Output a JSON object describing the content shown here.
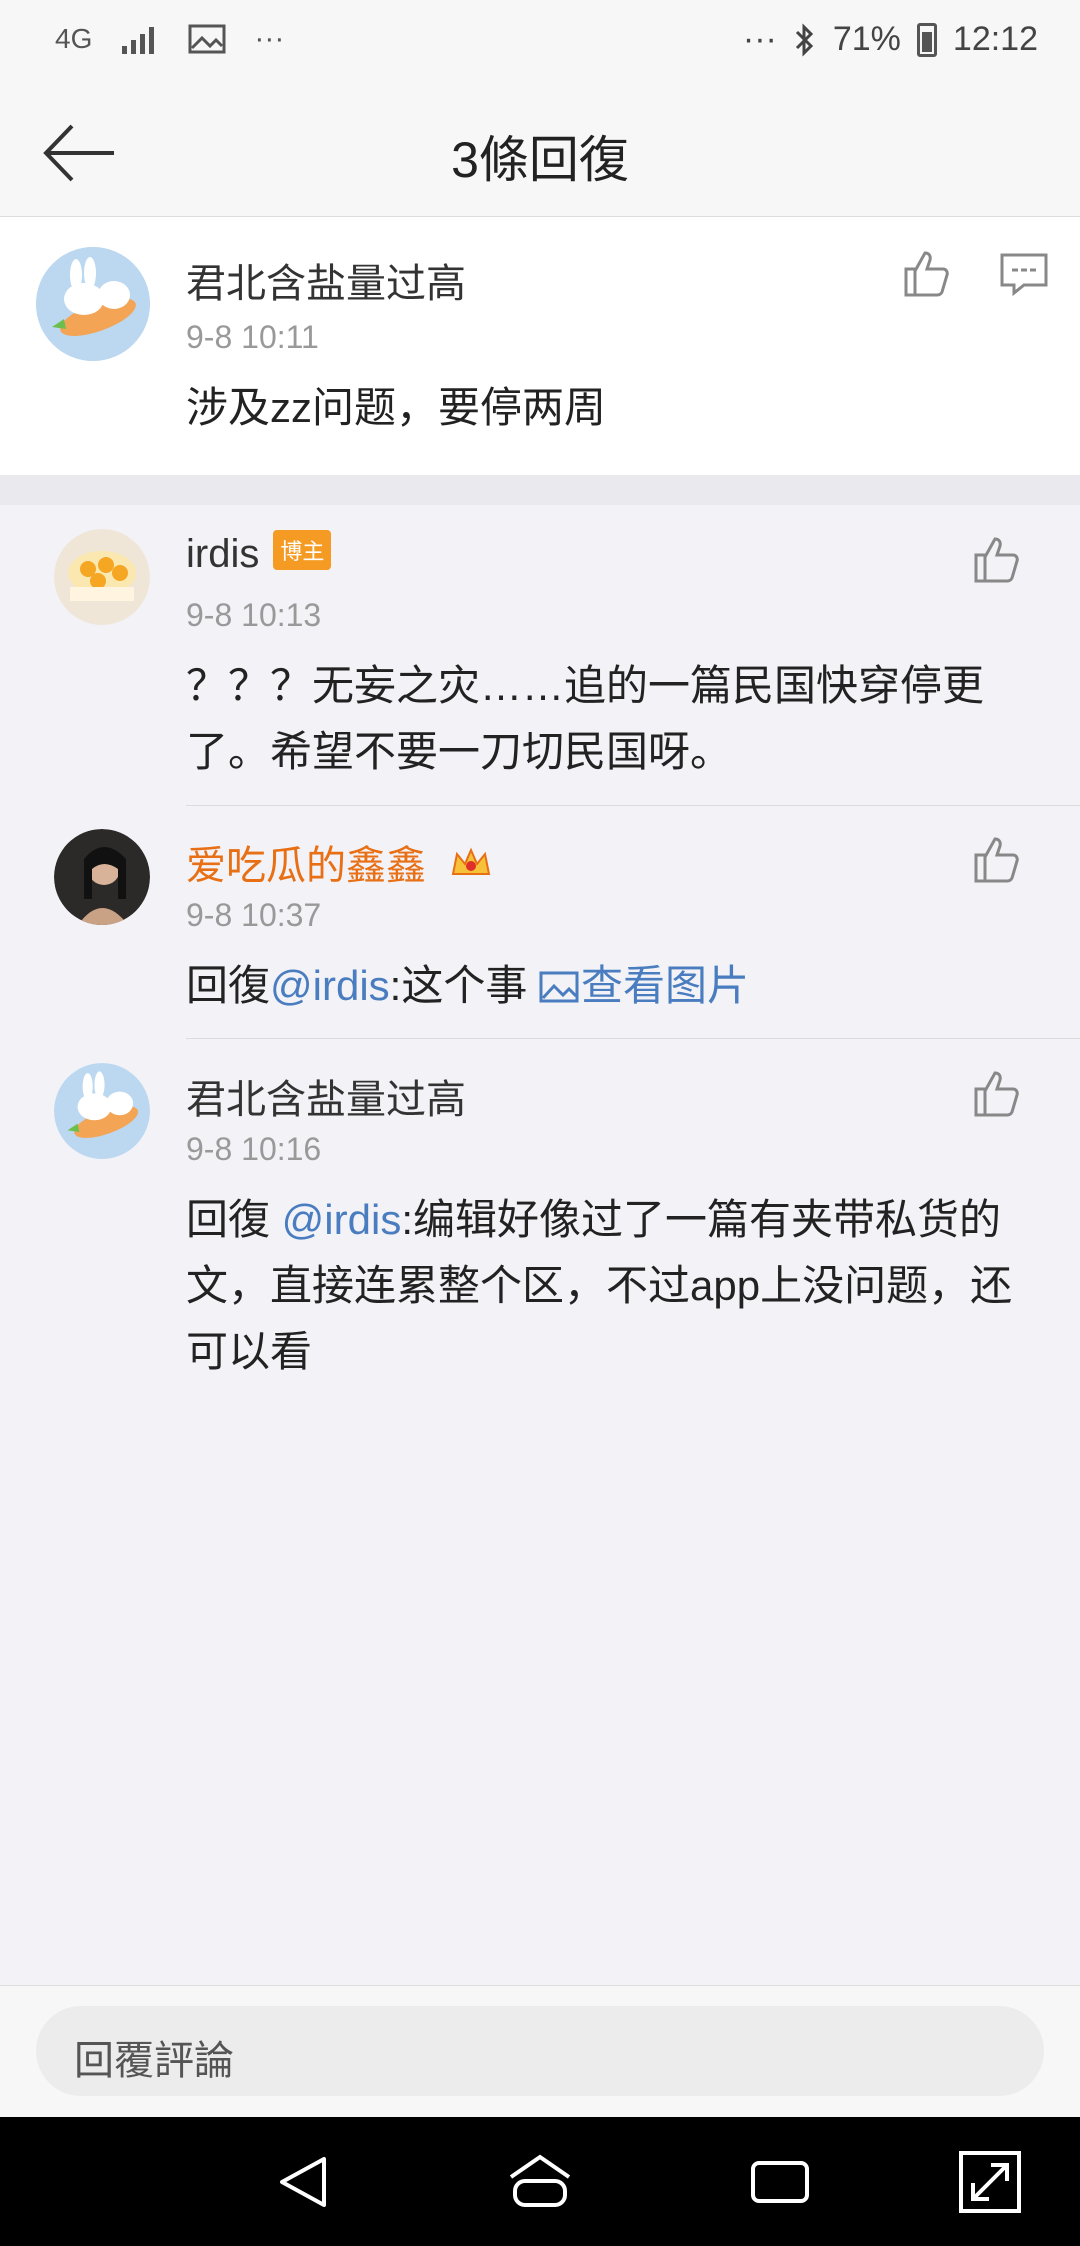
{
  "status_bar": {
    "network": "4G",
    "dots_left": "···",
    "dots_right": "···",
    "battery": "71%",
    "time": "12:12"
  },
  "header": {
    "title": "3條回復"
  },
  "root_comment": {
    "author": "君北含盐量过高",
    "time": "9-8 10:11",
    "text": "涉及zz问题，要停两周"
  },
  "replies": [
    {
      "author": "irdis",
      "badge": "博主",
      "time": "9-8 10:13",
      "line1": "？？？无妄之灾……追的一篇民国快穿停更",
      "line2": "了。希望不要一刀切民国呀。"
    },
    {
      "author": "爱吃瓜的鑫鑫",
      "time": "9-8 10:37",
      "prefix": "回復",
      "mention": "@irdis",
      "mid": ":这个事 ",
      "image_link": "查看图片"
    },
    {
      "author": "君北含盐量过高",
      "time": "9-8 10:16",
      "prefix": "回復 ",
      "mention": "@irdis",
      "line1_rest": ":编辑好像过了一篇有夹带私货的",
      "line2": "文，直接连累整个区，不过app上没问题，还",
      "line3": "可以看"
    }
  ],
  "input": {
    "placeholder": "回覆評論"
  },
  "colors": {
    "accent_link": "#4a7dbf",
    "vip_name": "#e86f13",
    "badge_bg": "#f59a23"
  }
}
